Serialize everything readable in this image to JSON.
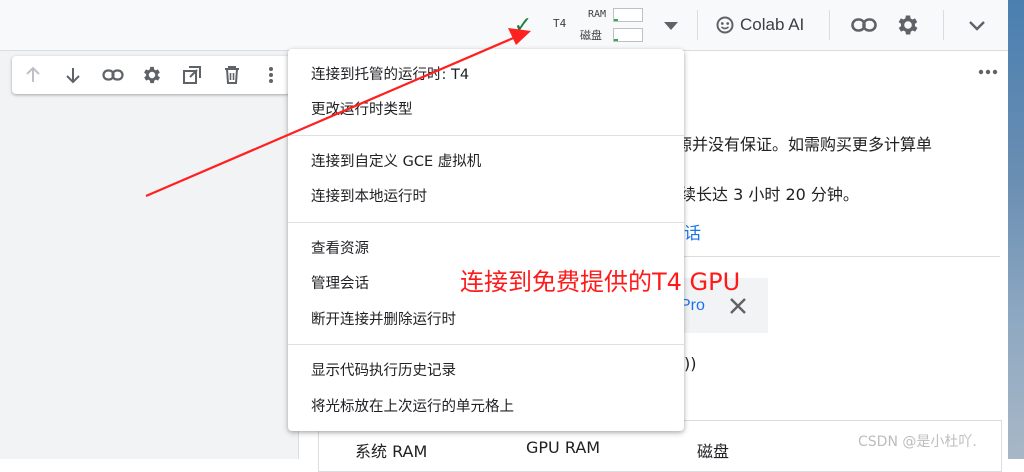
{
  "runtime": {
    "accelerator": "T4",
    "ram_label": "RAM",
    "disk_label": "磁盘",
    "status_color": "#188038",
    "ram_usage": 0.15,
    "disk_usage": 0.15
  },
  "header": {
    "colab_ai_label": "Colab AI",
    "icons": [
      "check-icon",
      "dropdown-arrow-icon",
      "colab-ai-icon",
      "link-icon",
      "settings-icon",
      "chevron-down-icon"
    ]
  },
  "cell_toolbar": {
    "icons": [
      "arrow-up-icon",
      "arrow-down-icon",
      "link-icon",
      "gear-icon",
      "mirror-cell-icon",
      "delete-icon",
      "more-vert-icon"
    ]
  },
  "background": {
    "line1": "源并没有保证。如需购买更多计算单",
    "line2": "续长达 3 小时 20 分钟。",
    "link": "话",
    "promo_text": "Pro",
    "paren": "))",
    "columns": [
      "系统 RAM",
      "GPU RAM",
      "磁盘"
    ]
  },
  "menu": {
    "groups": [
      [
        "连接到托管的运行时: T4",
        "更改运行时类型"
      ],
      [
        "连接到自定义 GCE 虚拟机",
        "连接到本地运行时"
      ],
      [
        "查看资源",
        "管理会话",
        "断开连接并删除运行时"
      ],
      [
        "显示代码执行历史记录",
        "将光标放在上次运行的单元格上"
      ]
    ]
  },
  "annotation": {
    "text": "连接到免费提供的T4  GPU",
    "color": "#ff1a1a"
  },
  "watermark": "CSDN @是小杜吖."
}
